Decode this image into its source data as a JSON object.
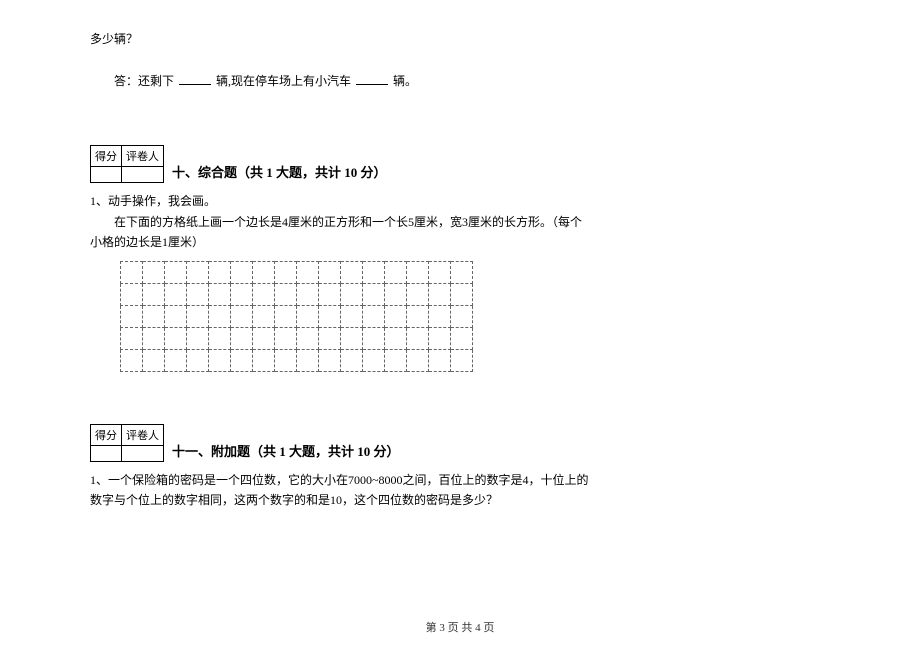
{
  "top": {
    "fragment": "多少辆？",
    "answer_line_prefix": "答：还剩下",
    "answer_line_mid": "辆,现在停车场上有小汽车",
    "answer_line_suffix": "辆。"
  },
  "score_table": {
    "header_score": "得分",
    "header_grader": "评卷人"
  },
  "section10": {
    "title": "十、综合题（共 1 大题，共计 10 分）",
    "q1_num": "1、动手操作，我会画。",
    "q1_line1": "在下面的方格纸上画一个边长是4厘米的正方形和一个长5厘米，宽3厘米的长方形。（每个",
    "q1_line2": "小格的边长是1厘米）"
  },
  "section11": {
    "title": "十一、附加题（共 1 大题，共计 10 分）",
    "q1_line1": "1、一个保险箱的密码是一个四位数，它的大小在7000~8000之间，百位上的数字是4，十位上的",
    "q1_line2": "数字与个位上的数字相同，这两个数字的和是10，这个四位数的密码是多少？"
  },
  "footer": {
    "text": "第 3 页 共 4 页"
  },
  "grid": {
    "rows": 5,
    "cols": 16
  }
}
